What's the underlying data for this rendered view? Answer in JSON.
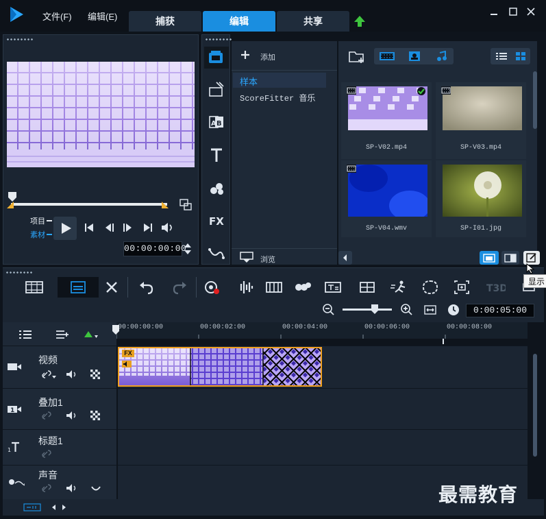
{
  "menu": {
    "file": "文件(F)",
    "edit": "编辑(E)"
  },
  "tabs": [
    {
      "label": "捕获",
      "active": false
    },
    {
      "label": "编辑",
      "active": true
    },
    {
      "label": "共享",
      "active": false
    }
  ],
  "preview": {
    "project_label": "项目",
    "clip_label": "素材",
    "timecode": "00:00:00:00",
    "scrub_progress": 0.0
  },
  "library": {
    "add_label": "添加",
    "folders": [
      {
        "label": "样本",
        "selected": true
      },
      {
        "label": "ScoreFitter 音乐",
        "selected": false
      }
    ],
    "browse_label": "浏览",
    "media": [
      {
        "name": "SP-V02.mp4",
        "type": "video",
        "checked": true
      },
      {
        "name": "SP-V03.mp4",
        "type": "video",
        "checked": false
      },
      {
        "name": "SP-V04.wmv",
        "type": "video",
        "checked": false
      },
      {
        "name": "SP-I01.jpg",
        "type": "image",
        "checked": false
      }
    ]
  },
  "toolbar": {
    "tooltip": "显示",
    "zoom_time": "0:00:05:00"
  },
  "timeline": {
    "ruler": [
      "00:00:00:00",
      "00:00:02:00",
      "00:00:04:00",
      "00:00:06:00",
      "00:00:08:00"
    ],
    "tracks": [
      {
        "name": "视频"
      },
      {
        "name": "叠加1"
      },
      {
        "name": "标题1"
      },
      {
        "name": "声音"
      }
    ],
    "clip_badge": "FX"
  },
  "watermark": "最需教育",
  "colors": {
    "accent": "#1a8ee0",
    "clip_border": "#f0a020",
    "panel": "#1b2532"
  }
}
